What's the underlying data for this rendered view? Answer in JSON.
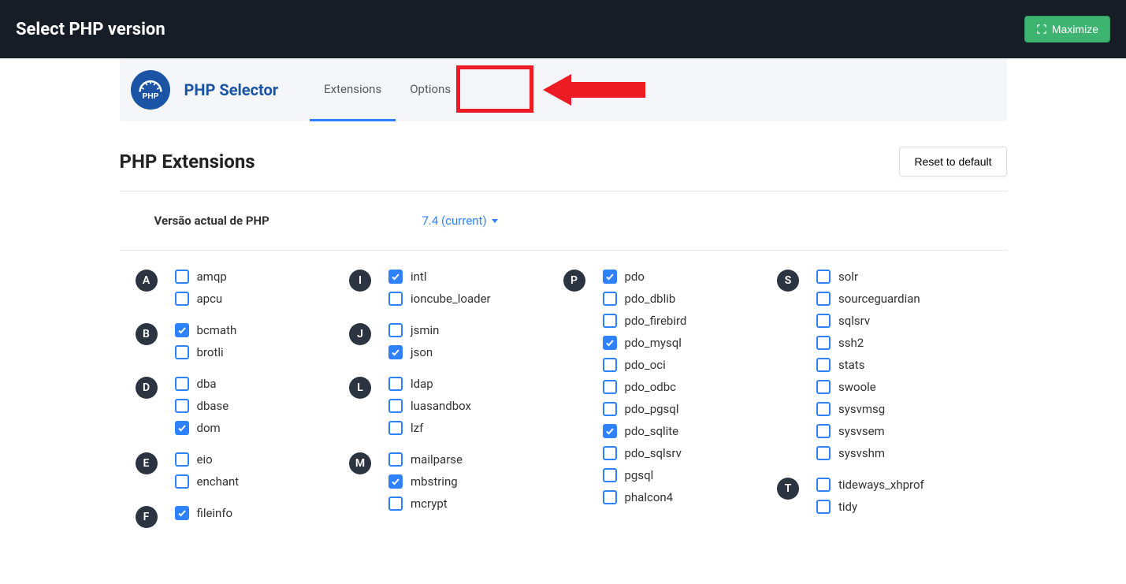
{
  "topbar": {
    "title": "Select PHP version",
    "maximize_label": "Maximize"
  },
  "header": {
    "selector_title": "PHP Selector",
    "tabs": [
      {
        "label": "Extensions",
        "active": true
      },
      {
        "label": "Options",
        "active": false
      }
    ]
  },
  "section": {
    "title": "PHP Extensions",
    "reset_label": "Reset to default"
  },
  "version": {
    "label": "Versão actual de PHP",
    "value": "7.4 (current)"
  },
  "columns": [
    {
      "groups": [
        {
          "letter": "A",
          "items": [
            {
              "name": "amqp",
              "checked": false
            },
            {
              "name": "apcu",
              "checked": false
            }
          ]
        },
        {
          "letter": "B",
          "items": [
            {
              "name": "bcmath",
              "checked": true
            },
            {
              "name": "brotli",
              "checked": false
            }
          ]
        },
        {
          "letter": "D",
          "items": [
            {
              "name": "dba",
              "checked": false
            },
            {
              "name": "dbase",
              "checked": false
            },
            {
              "name": "dom",
              "checked": true
            }
          ]
        },
        {
          "letter": "E",
          "items": [
            {
              "name": "eio",
              "checked": false
            },
            {
              "name": "enchant",
              "checked": false
            }
          ]
        },
        {
          "letter": "F",
          "items": [
            {
              "name": "fileinfo",
              "checked": true
            }
          ]
        }
      ]
    },
    {
      "groups": [
        {
          "letter": "I",
          "items": [
            {
              "name": "intl",
              "checked": true
            },
            {
              "name": "ioncube_loader",
              "checked": false
            }
          ]
        },
        {
          "letter": "J",
          "items": [
            {
              "name": "jsmin",
              "checked": false
            },
            {
              "name": "json",
              "checked": true
            }
          ]
        },
        {
          "letter": "L",
          "items": [
            {
              "name": "ldap",
              "checked": false
            },
            {
              "name": "luasandbox",
              "checked": false
            },
            {
              "name": "lzf",
              "checked": false
            }
          ]
        },
        {
          "letter": "M",
          "items": [
            {
              "name": "mailparse",
              "checked": false
            },
            {
              "name": "mbstring",
              "checked": true
            },
            {
              "name": "mcrypt",
              "checked": false
            }
          ]
        }
      ]
    },
    {
      "groups": [
        {
          "letter": "P",
          "items": [
            {
              "name": "pdo",
              "checked": true
            },
            {
              "name": "pdo_dblib",
              "checked": false
            },
            {
              "name": "pdo_firebird",
              "checked": false
            },
            {
              "name": "pdo_mysql",
              "checked": true
            },
            {
              "name": "pdo_oci",
              "checked": false
            },
            {
              "name": "pdo_odbc",
              "checked": false
            },
            {
              "name": "pdo_pgsql",
              "checked": false
            },
            {
              "name": "pdo_sqlite",
              "checked": true
            },
            {
              "name": "pdo_sqlsrv",
              "checked": false
            },
            {
              "name": "pgsql",
              "checked": false
            },
            {
              "name": "phalcon4",
              "checked": false
            }
          ]
        }
      ]
    },
    {
      "groups": [
        {
          "letter": "S",
          "items": [
            {
              "name": "solr",
              "checked": false
            },
            {
              "name": "sourceguardian",
              "checked": false
            },
            {
              "name": "sqlsrv",
              "checked": false
            },
            {
              "name": "ssh2",
              "checked": false
            },
            {
              "name": "stats",
              "checked": false
            },
            {
              "name": "swoole",
              "checked": false
            },
            {
              "name": "sysvmsg",
              "checked": false
            },
            {
              "name": "sysvsem",
              "checked": false
            },
            {
              "name": "sysvshm",
              "checked": false
            }
          ]
        },
        {
          "letter": "T",
          "items": [
            {
              "name": "tideways_xhprof",
              "checked": false
            },
            {
              "name": "tidy",
              "checked": false
            }
          ]
        }
      ]
    }
  ]
}
